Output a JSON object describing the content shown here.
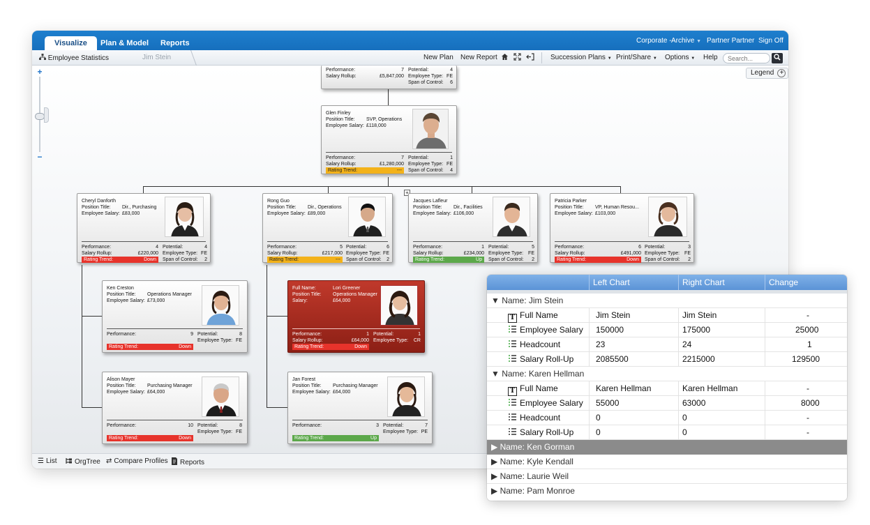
{
  "nav": {
    "tabs": [
      {
        "label": "Visualize",
        "active": true
      },
      {
        "label": "Plan & Model",
        "active": false
      },
      {
        "label": "Reports",
        "active": false
      }
    ],
    "right": {
      "corporate": "Corporate -",
      "archive": "Archive",
      "user": "Partner Partner",
      "signoff": "Sign Off"
    }
  },
  "toolbar": {
    "breadcrumb_root": "Employee Statistics",
    "breadcrumb_current": "Jim Stein",
    "new_plan": "New Plan",
    "new_report": "New Report",
    "succession_plans": "Succession Plans",
    "print_share": "Print/Share",
    "options": "Options",
    "help": "Help",
    "search_placeholder": "Search..."
  },
  "canvas": {
    "legend": "Legend",
    "zoom_plus": "+",
    "zoom_minus": "−"
  },
  "cards": {
    "top": {
      "stats": {
        "performance_label": "Performance:",
        "performance": "7",
        "salary_rollup_label": "Salary Rollup:",
        "salary_rollup": "£5,847,000",
        "potential_label": "Potential:",
        "potential": "4",
        "employee_type_label": "Employee Type:",
        "employee_type": "FE",
        "span_label": "Span of Control:",
        "span": "6"
      }
    },
    "glen": {
      "name": "Glen Finley",
      "position_label": "Position Title:",
      "position": "SVP, Operations",
      "salary_label": "Employee Salary:",
      "salary": "£118,000",
      "stats": {
        "performance_label": "Performance:",
        "performance": "7",
        "salary_rollup_label": "Salary Rollup:",
        "salary_rollup": "£1,280,000",
        "potential_label": "Potential:",
        "potential": "1",
        "employee_type_label": "Employee Type:",
        "employee_type": "FE",
        "span_label": "Span of Control:",
        "span": "4",
        "trend_label": "Rating Trend:",
        "trend": "---"
      }
    },
    "cheryl": {
      "name": "Cheryl Danforth",
      "position_label": "Position Title:",
      "position": "Dir., Purchasing",
      "salary_label": "Employee Salary:",
      "salary": "£83,000",
      "stats": {
        "performance_label": "Performance:",
        "performance": "4",
        "salary_rollup_label": "Salary Rollup:",
        "salary_rollup": "£220,000",
        "potential_label": "Potential:",
        "potential": "4",
        "employee_type_label": "Employee Type:",
        "employee_type": "FE",
        "span_label": "Span of Control:",
        "span": "2",
        "trend_label": "Rating Trend:",
        "trend": "Down"
      }
    },
    "rong": {
      "name": "Rong Guo",
      "position_label": "Position Title:",
      "position": "Dir., Operations",
      "salary_label": "Employee Salary:",
      "salary": "£89,000",
      "stats": {
        "performance_label": "Performance:",
        "performance": "5",
        "salary_rollup_label": "Salary Rollup:",
        "salary_rollup": "£217,000",
        "potential_label": "Potential:",
        "potential": "6",
        "employee_type_label": "Employee Type:",
        "employee_type": "FE",
        "span_label": "Span of Control:",
        "span": "2",
        "trend_label": "Rating Trend:",
        "trend": "---"
      }
    },
    "jacques": {
      "name": "Jacques Lafleur",
      "position_label": "Position Title:",
      "position": "Dir., Facilities",
      "salary_label": "Employee Salary:",
      "salary": "£106,000",
      "stats": {
        "performance_label": "Performance:",
        "performance": "1",
        "salary_rollup_label": "Salary Rollup:",
        "salary_rollup": "£234,000",
        "potential_label": "Potential:",
        "potential": "5",
        "employee_type_label": "Employee Type:",
        "employee_type": "FE",
        "span_label": "Span of Control:",
        "span": "2",
        "trend_label": "Rating Trend:",
        "trend": "Up"
      }
    },
    "patricia": {
      "name": "Patricia Parker",
      "position_label": "Position Title:",
      "position": "VP, Human Resou...",
      "salary_label": "Employee Salary:",
      "salary": "£103,000",
      "stats": {
        "performance_label": "Performance:",
        "performance": "6",
        "salary_rollup_label": "Salary Rollup:",
        "salary_rollup": "£491,000",
        "potential_label": "Potential:",
        "potential": "3",
        "employee_type_label": "Employee Type:",
        "employee_type": "FE",
        "span_label": "Span of Control:",
        "span": "2",
        "trend_label": "Rating Trend:",
        "trend": "Down"
      }
    },
    "ken": {
      "name": "Ken Creston",
      "position_label": "Position Title:",
      "position": "Operations Manager",
      "salary_label": "Employee Salary:",
      "salary": "£73,000",
      "stats": {
        "performance_label": "Performance:",
        "performance": "9",
        "potential_label": "Potential:",
        "potential": "8",
        "employee_type_label": "Employee Type:",
        "employee_type": "FE",
        "trend_label": "Rating Trend:",
        "trend": "Down"
      }
    },
    "lori": {
      "fullname_label": "Full Name:",
      "name": "Lori Greener",
      "position_label": "Position Title:",
      "position": "Operations Manager",
      "salary_label": "Salary:",
      "salary": "£64,000",
      "stats": {
        "performance_label": "Performance:",
        "performance": "1",
        "salary_rollup_label": "Salary Rollup:",
        "salary_rollup": "£64,000",
        "potential_label": "Potential:",
        "potential": "1",
        "employee_type_label": "Employee Type:",
        "employee_type": "CR",
        "trend_label": "Rating Trend:",
        "trend": "Down"
      }
    },
    "alison": {
      "name": "Alison Mayer",
      "position_label": "Position Title:",
      "position": "Purchasing Manager",
      "salary_label": "Employee Salary:",
      "salary": "£64,000",
      "stats": {
        "performance_label": "Performance:",
        "performance": "10",
        "potential_label": "Potential:",
        "potential": "8",
        "employee_type_label": "Employee Type:",
        "employee_type": "FE",
        "trend_label": "Rating Trend:",
        "trend": "Down"
      }
    },
    "jan": {
      "name": "Jan Forest",
      "position_label": "Position Title:",
      "position": "Purchasing Manager",
      "salary_label": "Employee Salary:",
      "salary": "£64,000",
      "stats": {
        "performance_label": "Performance:",
        "performance": "3",
        "potential_label": "Potential:",
        "potential": "7",
        "employee_type_label": "Employee Type:",
        "employee_type": "PE",
        "trend_label": "Rating Trend:",
        "trend": "Up"
      }
    }
  },
  "bottombar": {
    "list": "List",
    "orgtree": "OrgTree",
    "compare": "Compare Profiles",
    "reports": "Reports"
  },
  "compare": {
    "headers": [
      "Left Chart",
      "Right Chart",
      "Change"
    ],
    "groups": [
      {
        "title": "▼ Name: Jim Stein",
        "rows": [
          {
            "field": "Full Name",
            "icon": "text-icon",
            "left": "Jim Stein",
            "right": "Jim Stein",
            "change": "-"
          },
          {
            "field": "Employee Salary",
            "icon": "number-green-icon",
            "left": "150000",
            "right": "175000",
            "change": "25000"
          },
          {
            "field": "Headcount",
            "icon": "number-green-icon",
            "left": "23",
            "right": "24",
            "change": "1"
          },
          {
            "field": "Salary Roll-Up",
            "icon": "number-green-icon",
            "left": "2085500",
            "right": "2215000",
            "change": "129500"
          }
        ]
      },
      {
        "title": "▼ Name: Karen Hellman",
        "rows": [
          {
            "field": "Full Name",
            "icon": "text-icon",
            "left": "Karen Hellman",
            "right": "Karen Hellman",
            "change": "-"
          },
          {
            "field": "Employee Salary",
            "icon": "number-green-icon",
            "left": "55000",
            "right": "63000",
            "change": "8000"
          },
          {
            "field": "Headcount",
            "icon": "number-dark-icon",
            "left": "0",
            "right": "0",
            "change": "-"
          },
          {
            "field": "Salary Roll-Up",
            "icon": "number-dark-icon",
            "left": "0",
            "right": "0",
            "change": "-"
          }
        ]
      }
    ],
    "collapsed": [
      "▶ Name: Ken Gorman",
      "▶ Name: Kyle Kendall",
      "▶ Name: Laurie Weil",
      "▶ Name: Pam Monroe"
    ],
    "colors": {
      "header": "#6aa2df",
      "selected": "#8b8b8b",
      "icon_green": "#3aa63a"
    }
  }
}
